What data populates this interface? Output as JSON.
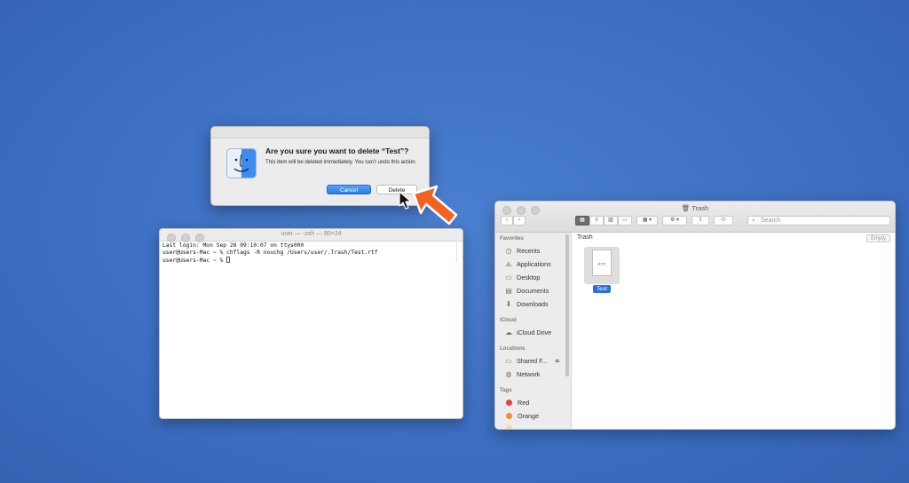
{
  "dialog": {
    "title": "Are you sure you want to delete “Test”?",
    "message": "This item will be deleted immediately. You can’t undo this action.",
    "cancel_label": "Cancel",
    "delete_label": "Delete"
  },
  "terminal": {
    "title": "user — -zsh — 80×24",
    "lines": [
      "Last login: Mon Sep 28 09:10:07 on ttys000",
      "user@Users-Mac ~ % chflags -R nouchg /Users/user/.Trash/Test.rtf",
      "user@Users-Mac ~ % "
    ]
  },
  "finder": {
    "window_title": "Trash",
    "search_placeholder": "Search",
    "path_label": "Trash",
    "empty_label": "Empty",
    "sidebar": {
      "favorites_header": "Favorites",
      "favorites": [
        "Recents",
        "Applications",
        "Desktop",
        "Documents",
        "Downloads"
      ],
      "icloud_header": "iCloud",
      "icloud": [
        "iCloud Drive"
      ],
      "locations_header": "Locations",
      "locations": [
        "Shared F...",
        "Network"
      ],
      "tags_header": "Tags",
      "tags": [
        {
          "name": "Red",
          "color": "#e0473a"
        },
        {
          "name": "Orange",
          "color": "#f0902e"
        }
      ]
    },
    "file": {
      "name": "Test",
      "ext": "RTF"
    }
  },
  "colors": {
    "desktop": "#3d6fc2",
    "accent": "#2a7ae9",
    "pointer_arrow": "#f26322"
  }
}
